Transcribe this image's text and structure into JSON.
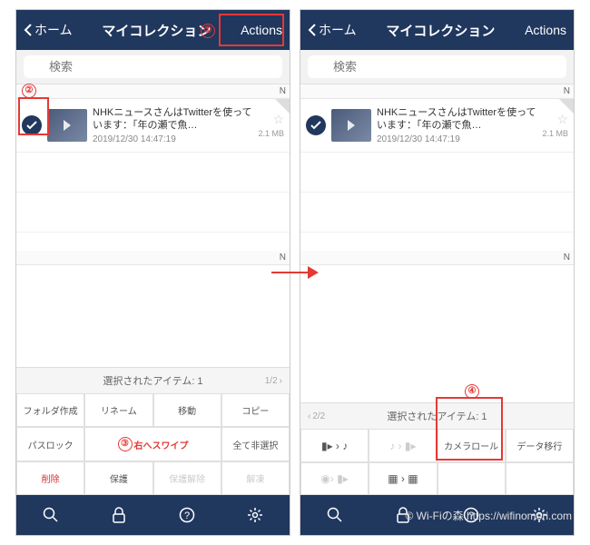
{
  "left": {
    "header": {
      "back": "ホーム",
      "title": "マイコレクション",
      "action": "Actions"
    },
    "search": {
      "placeholder": "検索"
    },
    "section": "N",
    "item": {
      "title": "NHKニュースさんはTwitterを使っています：「年の瀬で魚…",
      "date": "2019/12/30 14:47:19",
      "size": "2.1 MB"
    },
    "section2": "N",
    "selHeader": "選択されたアイテム: 1",
    "pager": "1/2",
    "actions": {
      "r1": [
        "フォルダ作成",
        "リネーム",
        "移動",
        "コピー"
      ],
      "r2": [
        "パスロック",
        "",
        "",
        "全て非選択"
      ],
      "r3": [
        "削除",
        "保護",
        "保護解除",
        "解凍"
      ]
    },
    "swipe": "右へスワイプ"
  },
  "right": {
    "header": {
      "back": "ホーム",
      "title": "マイコレクション",
      "action": "Actions"
    },
    "search": {
      "placeholder": "検索"
    },
    "section": "N",
    "item": {
      "title": "NHKニュースさんはTwitterを使っています：「年の瀬で魚…",
      "date": "2019/12/30 14:47:19",
      "size": "2.1 MB"
    },
    "section2": "N",
    "selHeader": "選択されたアイテム: 1",
    "pager": "2/2",
    "actions": {
      "r1c3": "カメラロール",
      "r1c4": "データ移行"
    }
  },
  "annotations": {
    "a1": "①",
    "a2": "②",
    "a3": "③",
    "a4": "④"
  },
  "watermark": "© Wi-Fiの森  https://wifinomori.com"
}
